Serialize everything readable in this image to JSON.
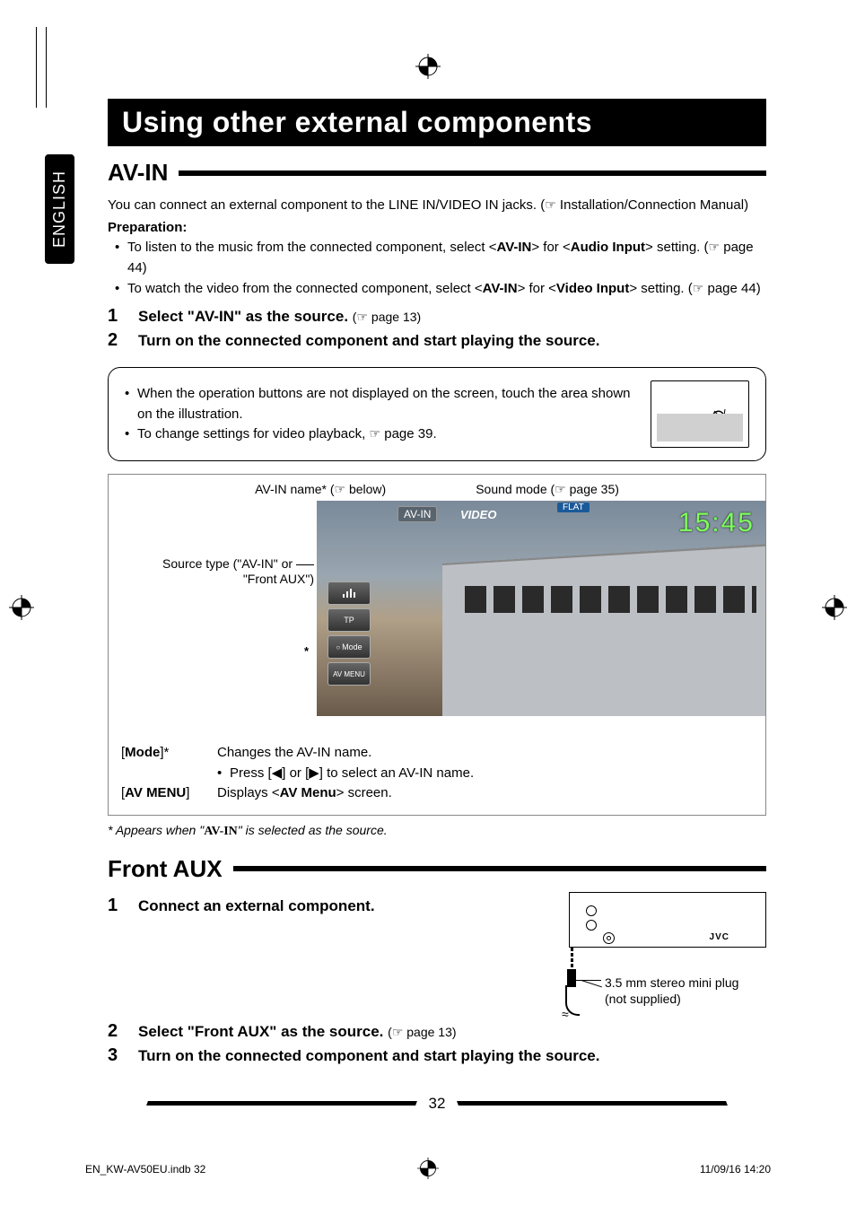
{
  "lang_tab": "ENGLISH",
  "title": "Using other external components",
  "section_avin": {
    "heading": "AV-IN",
    "lead_pre": "You can connect an external component to the LINE IN/VIDEO IN jacks. (",
    "lead_post": " Installation/Connection Manual)",
    "prep_label": "Preparation:",
    "bullets": {
      "b1": {
        "pre": "To listen to the music from the connected component, select <",
        "k1": "AV-IN",
        "mid": "> for <",
        "k2": "Audio Input",
        "post": "> setting. (",
        "page": " page 44)"
      },
      "b2": {
        "pre": "To watch the video from the connected component, select <",
        "k1": "AV-IN",
        "mid": "> for <",
        "k2": "Video Input",
        "post": "> setting. (",
        "page": " page 44)"
      }
    },
    "steps": {
      "s1": {
        "num": "1",
        "text": "Select \"AV-IN\" as the source.",
        "ref": " page 13)"
      },
      "s2": {
        "num": "2",
        "text": "Turn on the connected component and start playing the source."
      }
    },
    "tips": {
      "t1": "When the operation buttons are not displayed on the screen, touch the area shown on the illustration.",
      "t2_pre": "To change settings for video playback, ",
      "t2_post": " page 39."
    },
    "callouts": {
      "avin_name_pre": "AV-IN name* (",
      "avin_name_post": " below)",
      "sound_mode_pre": "Sound mode (",
      "sound_mode_post": " page 35)",
      "source_type_l1": "Source type (\"AV-IN\" or",
      "source_type_l2": "\"Front AUX\")",
      "star": "*"
    },
    "screen": {
      "tag": "AV-IN",
      "subtitle": "VIDEO",
      "flat": "FLAT",
      "clock": "15:45",
      "tp": "TP",
      "mode": "Mode",
      "avmenu": "AV MENU"
    },
    "func": {
      "mode_key_pre": "[",
      "mode_key_bold": "Mode",
      "mode_key_post": "]*",
      "mode_val": "Changes the AV-IN name.",
      "mode_sub_pre": "Press [",
      "mode_sub_mid": "] or [",
      "mode_sub_post": "] to select an AV-IN name.",
      "avmenu_key_pre": "[",
      "avmenu_key_bold": "AV MENU",
      "avmenu_key_post": "]",
      "avmenu_val_pre": "Displays <",
      "avmenu_val_bold": "AV Menu",
      "avmenu_val_post": "> screen."
    },
    "footnote_pre": "*  Appears when \"",
    "footnote_avin": "AV-IN",
    "footnote_post": "\" is selected as the source."
  },
  "section_aux": {
    "heading": "Front AUX",
    "steps": {
      "s1": {
        "num": "1",
        "text": "Connect an external component."
      },
      "s2": {
        "num": "2",
        "text": "Select \"Front AUX\" as the source.",
        "ref": " page 13)"
      },
      "s3": {
        "num": "3",
        "text": "Turn on the connected component and start playing the source."
      }
    },
    "jvc": "JVC",
    "plug_l1": "3.5 mm stereo mini plug",
    "plug_l2": "(not supplied)"
  },
  "page_number": "32",
  "footer": {
    "left": "EN_KW-AV50EU.indb   32",
    "right": "11/09/16   14:20"
  },
  "icons": {
    "pointer": "☞",
    "tri_left": "◀",
    "tri_right": "▶"
  }
}
